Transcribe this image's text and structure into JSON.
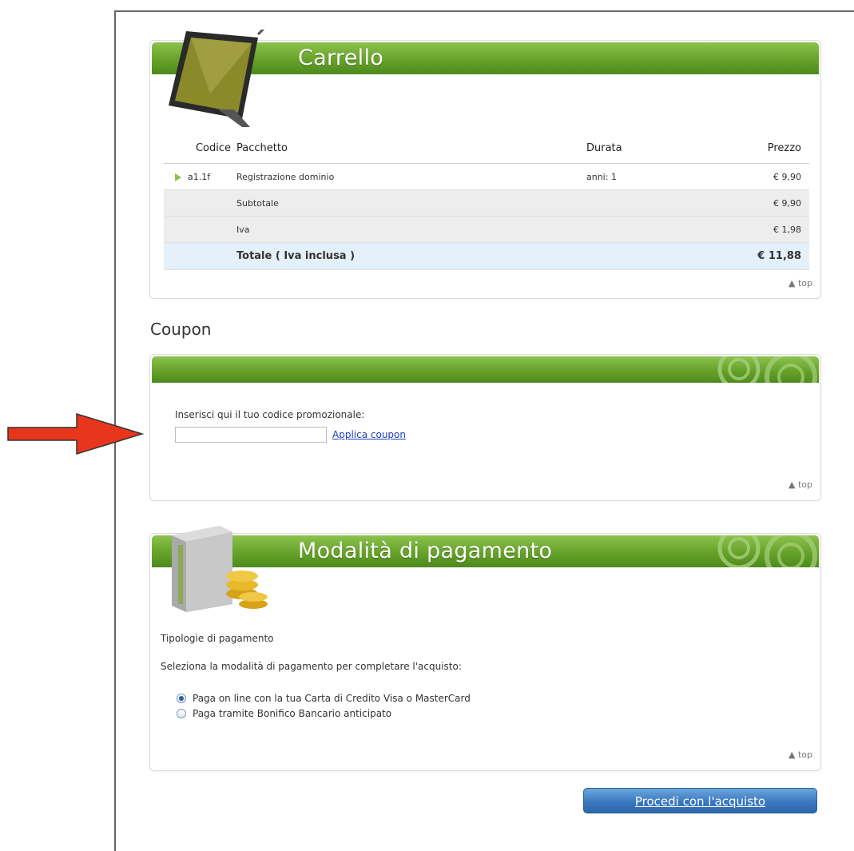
{
  "cart": {
    "title": "Carrello",
    "columns": {
      "code": "Codice",
      "package": "Pacchetto",
      "duration": "Durata",
      "price": "Prezzo"
    },
    "items": [
      {
        "code": "a1.1f",
        "package": "Registrazione dominio",
        "duration": "anni: 1",
        "price": "€ 9,90"
      }
    ],
    "subtotal_label": "Subtotale",
    "subtotal_value": "€ 9,90",
    "iva_label": "Iva",
    "iva_value": "€ 1,98",
    "total_label": "Totale ( Iva inclusa )",
    "total_value": "€ 11,88",
    "top_link": "top"
  },
  "coupon": {
    "heading": "Coupon",
    "label": "Inserisci qui il tuo codice promozionale:",
    "input_value": "",
    "apply_link": "Applica coupon",
    "top_link": "top"
  },
  "payment": {
    "title": "Modalità di pagamento",
    "types_label": "Tipologie di pagamento",
    "instruction": "Seleziona la modalità di pagamento per completare l'acquisto:",
    "options": [
      {
        "label": "Paga on line con la tua Carta di Credito Visa o MasterCard",
        "selected": true
      },
      {
        "label": "Paga tramite Bonifico Bancario anticipato",
        "selected": false
      }
    ],
    "top_link": "top"
  },
  "proceed_button": "Procedi con l'acquisto",
  "colors": {
    "header_green": "#66a22a",
    "price_orange": "#e0502a",
    "button_blue": "#3a79bf",
    "arrow_red": "#e8361c"
  }
}
